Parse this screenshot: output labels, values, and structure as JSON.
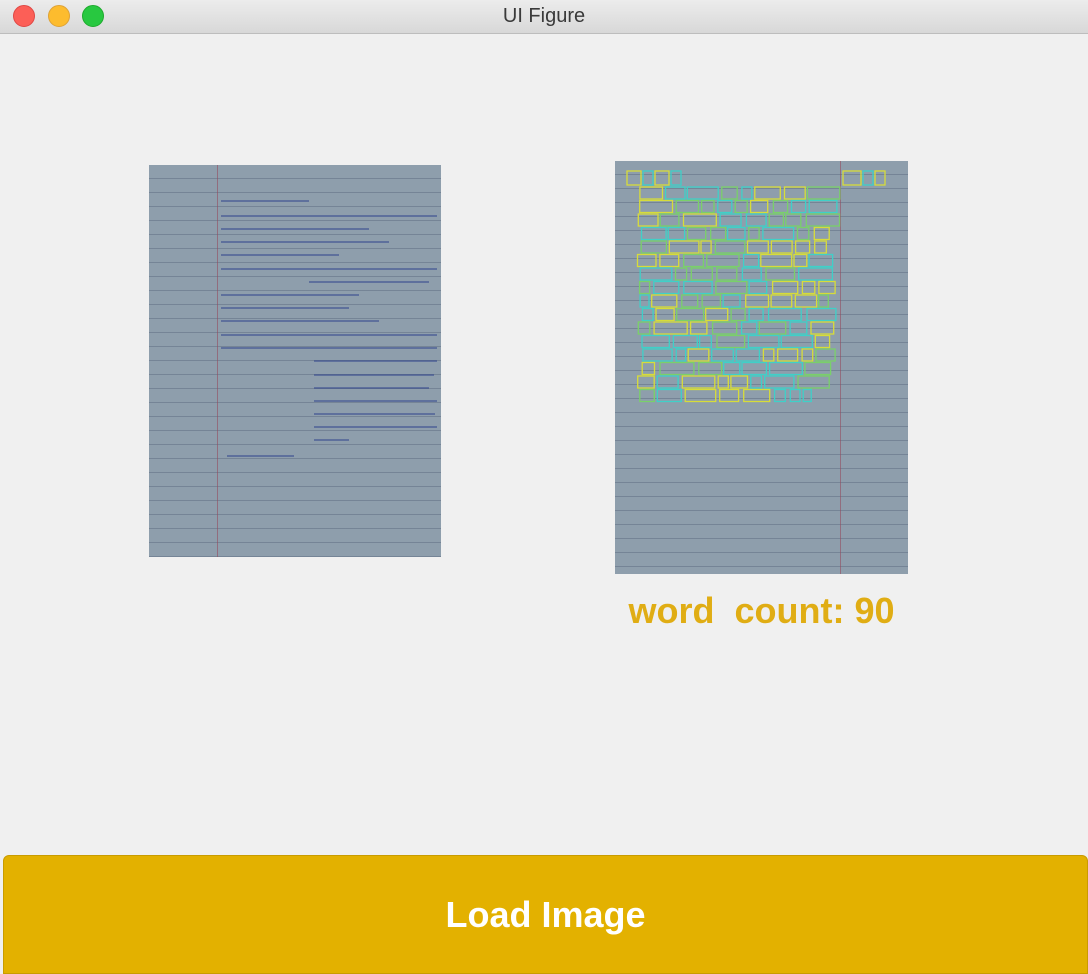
{
  "window": {
    "title": "UI Figure"
  },
  "images": {
    "original": {
      "description_icon": "handwritten-page-image"
    },
    "processed": {
      "description_icon": "detected-words-image"
    }
  },
  "result": {
    "word_count_text": "word  count: 90"
  },
  "actions": {
    "load_label": "Load Image"
  },
  "colors": {
    "accent": "#e3b100",
    "count_text": "#e0ad14",
    "paper": "#8e9eac"
  }
}
